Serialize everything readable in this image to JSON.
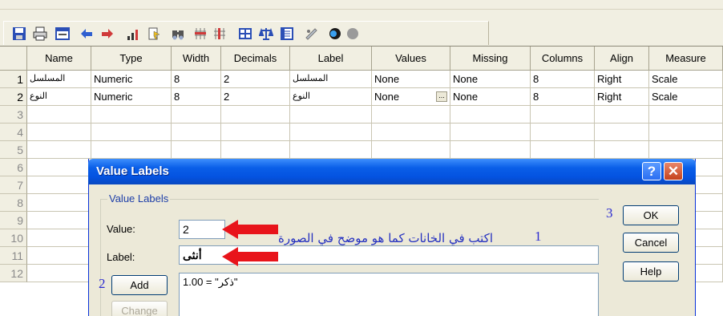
{
  "toolbar": {
    "icons": [
      "save-icon",
      "print-icon",
      "dialog-recall-icon",
      "undo-icon",
      "redo-icon",
      "goto-case-icon",
      "variables-icon",
      "find-icon",
      "insert-cases-icon",
      "insert-variable-icon",
      "split-file-icon",
      "weight-cases-icon",
      "select-cases-icon",
      "value-labels-icon",
      "use-sets-icon",
      "show-all-icon"
    ]
  },
  "grid": {
    "columns": [
      "Name",
      "Type",
      "Width",
      "Decimals",
      "Label",
      "Values",
      "Missing",
      "Columns",
      "Align",
      "Measure"
    ],
    "rows": [
      {
        "num": "1",
        "cells": [
          "المسلسل",
          "Numeric",
          "8",
          "2",
          "المسلسل",
          "None",
          "None",
          "8",
          "Right",
          "Scale"
        ]
      },
      {
        "num": "2",
        "cells": [
          "النوع",
          "Numeric",
          "8",
          "2",
          "النوع",
          "None",
          "None",
          "8",
          "Right",
          "Scale"
        ]
      }
    ],
    "empty_rows": [
      "3",
      "4",
      "5",
      "6",
      "7",
      "8",
      "9",
      "10",
      "11",
      "12"
    ],
    "ellipsis": "..."
  },
  "dialog": {
    "title": "Value Labels",
    "help_glyph": "?",
    "close_glyph": "✕",
    "group_label": "Value Labels",
    "value_label": "Value:",
    "value": "2",
    "label_label": "Label:",
    "label_value": "أنثى",
    "add": "Add",
    "change": "Change",
    "ok": "OK",
    "cancel": "Cancel",
    "help": "Help",
    "list_item": "1.00 = \"ذكر\""
  },
  "annotations": {
    "n1": "1",
    "n2": "2",
    "n3": "3",
    "instruction": "اكتب في الخانات كما هو موضح في الصورة",
    "arrow_color": "#e8141a"
  }
}
